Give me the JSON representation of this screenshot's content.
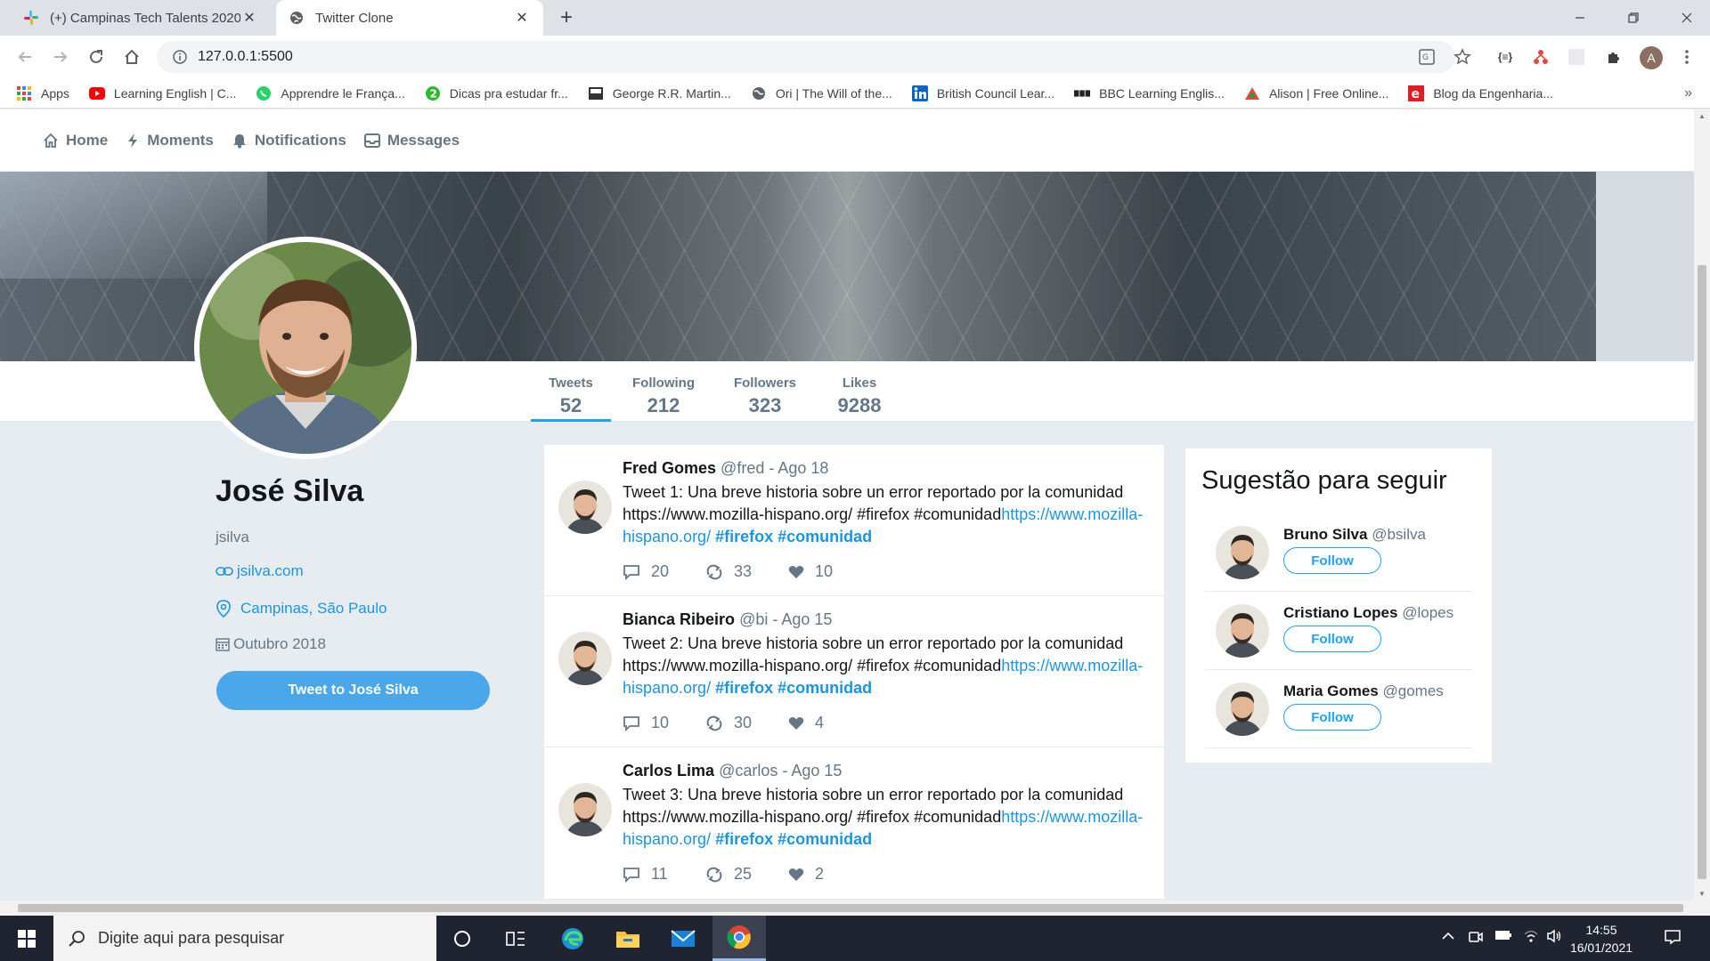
{
  "browser": {
    "tabs": [
      {
        "label": "(+) Campinas Tech Talents 2020 |",
        "active": false
      },
      {
        "label": "Twitter Clone",
        "active": true
      }
    ],
    "url": "127.0.0.1:5500",
    "profile_initial": "A",
    "bookmarks": [
      {
        "label": "Apps",
        "icon": "apps-grid-icon"
      },
      {
        "label": "Learning English | C...",
        "icon": "youtube-icon"
      },
      {
        "label": "Apprendre le França...",
        "icon": "whatsapp-icon"
      },
      {
        "label": "Dicas pra estudar fr...",
        "icon": "circle-2-icon"
      },
      {
        "label": "George R.R. Martin...",
        "icon": "book-icon"
      },
      {
        "label": "Ori | The Will of the...",
        "icon": "globe-icon"
      },
      {
        "label": "British Council Lear...",
        "icon": "linkedin-icon"
      },
      {
        "label": "BBC Learning Englis...",
        "icon": "bbc-icon"
      },
      {
        "label": "Alison | Free Online...",
        "icon": "alison-icon"
      },
      {
        "label": "Blog da Engenharia...",
        "icon": "blog-e-icon"
      }
    ],
    "bookmarks_overflow": "»"
  },
  "nav": {
    "home": "Home",
    "moments": "Moments",
    "notifications": "Notifications",
    "messages": "Messages"
  },
  "stats": [
    {
      "label": "Tweets",
      "value": "52",
      "active": true
    },
    {
      "label": "Following",
      "value": "212",
      "active": false
    },
    {
      "label": "Followers",
      "value": "323",
      "active": false
    },
    {
      "label": "Likes",
      "value": "9288",
      "active": false
    }
  ],
  "profile": {
    "name": "José Silva",
    "handle": "jsilva",
    "website": "jsilva.com",
    "location": "Campinas, São Paulo",
    "joined": "Outubro 2018",
    "tweet_button": "Tweet to José Silva"
  },
  "tweets": [
    {
      "name": "Fred Gomes",
      "handle": "@fred",
      "date": "- Ago 18",
      "text": "Tweet 1: Una breve historia sobre un error reportado por la comunidad https://www.mozilla-hispano.org/ #firefox #comunidad",
      "link": "https://www.mozilla-hispano.org/",
      "tag1": "#firefox",
      "tag2": "#comunidad",
      "replies": "20",
      "retweets": "33",
      "likes": "10"
    },
    {
      "name": "Bianca Ribeiro",
      "handle": "@bi",
      "date": "- Ago 15",
      "text": "Tweet 2: Una breve historia sobre un error reportado por la comunidad https://www.mozilla-hispano.org/ #firefox #comunidad",
      "link": "https://www.mozilla-hispano.org/",
      "tag1": "#firefox",
      "tag2": "#comunidad",
      "replies": "10",
      "retweets": "30",
      "likes": "4"
    },
    {
      "name": "Carlos Lima",
      "handle": "@carlos",
      "date": "- Ago 15",
      "text": "Tweet 3: Una breve historia sobre un error reportado por la comunidad https://www.mozilla-hispano.org/ #firefox #comunidad",
      "link": "https://www.mozilla-hispano.org/",
      "tag1": "#firefox",
      "tag2": "#comunidad",
      "replies": "11",
      "retweets": "25",
      "likes": "2"
    }
  ],
  "suggestions": {
    "title": "Sugestão para seguir",
    "items": [
      {
        "name": "Bruno Silva",
        "handle": "@bsilva",
        "button": "Follow"
      },
      {
        "name": "Cristiano Lopes",
        "handle": "@lopes",
        "button": "Follow"
      },
      {
        "name": "Maria Gomes",
        "handle": "@gomes",
        "button": "Follow"
      }
    ]
  },
  "taskbar": {
    "search_placeholder": "Digite aqui para pesquisar",
    "time": "14:55",
    "date": "16/01/2021"
  },
  "colors": {
    "accent": "#1da1f2",
    "link": "#1b95e0",
    "page_bg": "#e6ecf0"
  }
}
